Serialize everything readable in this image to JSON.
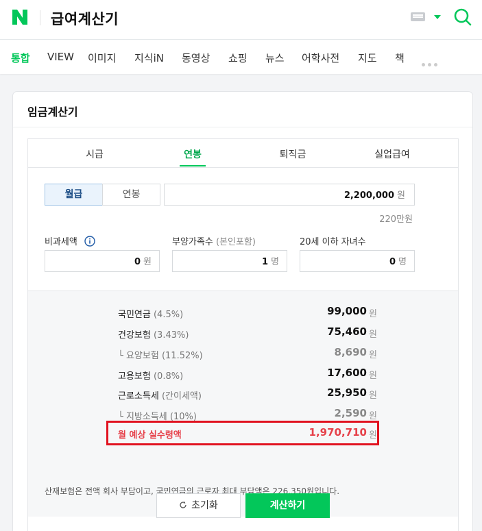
{
  "header": {
    "query": "급여계산기",
    "accent": "#03c75a"
  },
  "nav": {
    "items": [
      "통합",
      "VIEW",
      "이미지",
      "지식iN",
      "동영상",
      "쇼핑",
      "뉴스",
      "어학사전",
      "지도",
      "책"
    ],
    "active": "통합"
  },
  "card": {
    "title": "임금계산기",
    "tabs": [
      "시급",
      "연봉",
      "퇴직금",
      "실업급여"
    ],
    "active_tab": "연봉"
  },
  "input": {
    "period_options": [
      "월급",
      "연봉"
    ],
    "selected_period": "월급",
    "salary": "2,200,000",
    "salary_unit": "원",
    "salary_hint": "220만원",
    "nontax_label": "비과세액",
    "nontax_value": "0",
    "nontax_unit": "원",
    "dependents_label": "부양가족수",
    "dependents_sub": "(본인포함)",
    "dependents_value": "1",
    "dependents_unit": "명",
    "children_label": "20세 이하 자녀수",
    "children_value": "0",
    "children_unit": "명"
  },
  "result": {
    "rows": [
      {
        "label": "국민연금",
        "sub": "(4.5%)",
        "value": "99,000",
        "unit": "원"
      },
      {
        "label": "건강보험",
        "sub": "(3.43%)",
        "value": "75,460",
        "unit": "원"
      },
      {
        "label": "└ 요양보험",
        "sub": "(11.52%)",
        "value": "8,690",
        "unit": "원"
      },
      {
        "label": "고용보험",
        "sub": "(0.8%)",
        "value": "17,600",
        "unit": "원"
      },
      {
        "label": "근로소득세",
        "sub": "(간이세액)",
        "value": "25,950",
        "unit": "원"
      },
      {
        "label": "└ 지방소득세",
        "sub": "(10%)",
        "value": "2,590",
        "unit": "원"
      }
    ],
    "net_label": "월 예상 실수령액",
    "net_value": "1,970,710",
    "net_unit": "원",
    "highlight_color": "#e1121f"
  },
  "notice": "산재보험은 전액 회사 부담이고, 국민연금의 근로자 최대 부담액은 226,350원입니다.",
  "buttons": {
    "reset": "초기화",
    "calculate": "계산하기"
  }
}
